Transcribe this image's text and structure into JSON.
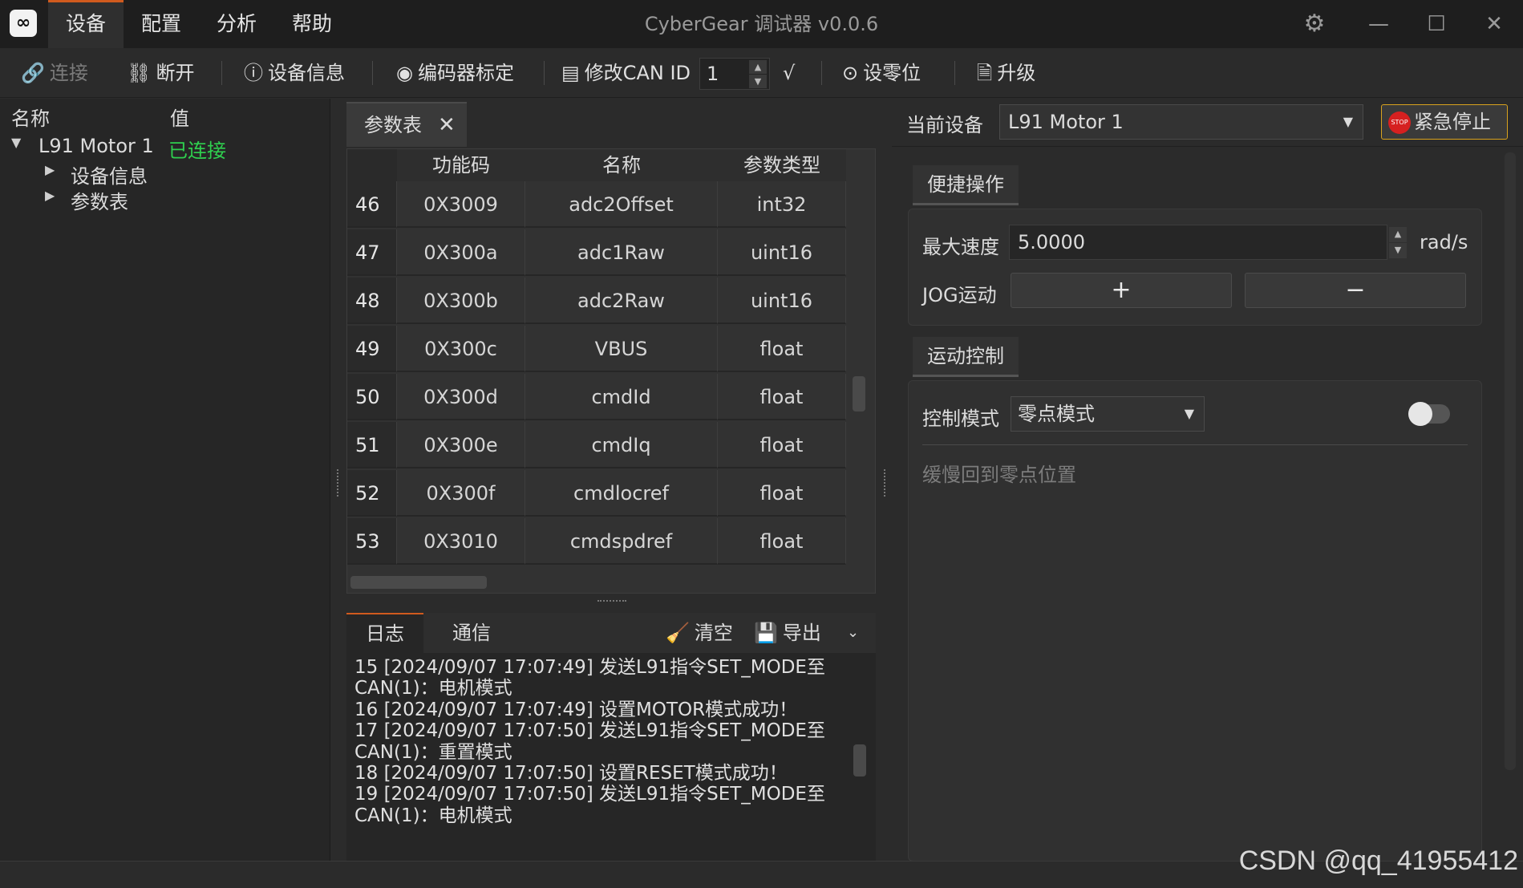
{
  "app": {
    "title": "CyberGear 调试器 v0.0.6",
    "logo_icon": "link-logo-icon",
    "menu": [
      "设备",
      "配置",
      "分析",
      "帮助"
    ],
    "active_menu": "设备"
  },
  "toolbar": {
    "connect": "连接",
    "disconnect": "断开",
    "device_info": "设备信息",
    "encoder_calib": "编码器标定",
    "modify_can_id": "修改CAN ID",
    "can_id_value": "1",
    "confirm": "√",
    "set_zero": "设零位",
    "upgrade": "升级"
  },
  "tree": {
    "col_name": "名称",
    "col_value": "值",
    "device_name": "L91 Motor 1",
    "device_status": "已连接",
    "status_color": "#2fcf4f",
    "children": [
      "设备信息",
      "参数表"
    ]
  },
  "param_table": {
    "tab_label": "参数表",
    "headers": [
      "功能码",
      "名称",
      "参数类型"
    ],
    "rows": [
      {
        "idx": "46",
        "code": "0X3009",
        "name": "adc2Offset",
        "type": "int32"
      },
      {
        "idx": "47",
        "code": "0X300a",
        "name": "adc1Raw",
        "type": "uint16"
      },
      {
        "idx": "48",
        "code": "0X300b",
        "name": "adc2Raw",
        "type": "uint16"
      },
      {
        "idx": "49",
        "code": "0X300c",
        "name": "VBUS",
        "type": "float"
      },
      {
        "idx": "50",
        "code": "0X300d",
        "name": "cmdId",
        "type": "float"
      },
      {
        "idx": "51",
        "code": "0X300e",
        "name": "cmdIq",
        "type": "float"
      },
      {
        "idx": "52",
        "code": "0X300f",
        "name": "cmdlocref",
        "type": "float"
      },
      {
        "idx": "53",
        "code": "0X3010",
        "name": "cmdspdref",
        "type": "float"
      }
    ]
  },
  "log": {
    "tabs": [
      "日志",
      "通信"
    ],
    "clear": "清空",
    "export": "导出",
    "lines": [
      "15 [2024/09/07 17:07:49] 发送L91指令SET_MODE至",
      "CAN(1)：电机模式",
      "16 [2024/09/07 17:07:49] 设置MOTOR模式成功！",
      "17 [2024/09/07 17:07:50] 发送L91指令SET_MODE至",
      "CAN(1)：重置模式",
      "18 [2024/09/07 17:07:50] 设置RESET模式成功！",
      "19 [2024/09/07 17:07:50] 发送L91指令SET_MODE至",
      "CAN(1)：电机模式"
    ]
  },
  "right": {
    "current_device_label": "当前设备",
    "current_device": "L91 Motor 1",
    "estop": "紧急停止",
    "estop_color": "#d62020",
    "quick_tab": "便捷操作",
    "max_speed_label": "最大速度",
    "max_speed_value": "5.0000",
    "speed_unit": "rad/s",
    "jog_label": "JOG运动",
    "jog_plus": "+",
    "jog_minus": "−",
    "motion_tab": "运动控制",
    "control_mode_label": "控制模式",
    "control_mode_value": "零点模式",
    "mode_desc": "缓慢回到零点位置"
  },
  "watermark": "CSDN @qq_41955412"
}
